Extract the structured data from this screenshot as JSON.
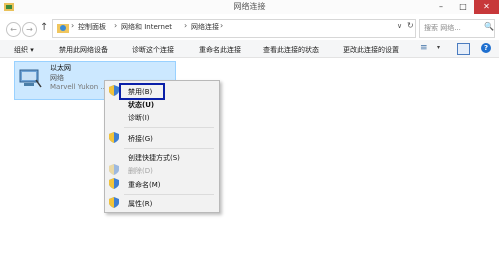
{
  "window": {
    "title": "网络连接",
    "controls": {
      "minimize": "–",
      "maximize": "□",
      "close": "✕"
    }
  },
  "address_bar": {
    "nav": {
      "back": "←",
      "forward": "→",
      "up": "↑"
    },
    "breadcrumbs": [
      "控制面板",
      "网络和 Internet",
      "网络连接"
    ],
    "separator": "›",
    "dropdown": "∨",
    "refresh": "↻",
    "search_placeholder": "搜索 网络...",
    "search_icon": "🔍"
  },
  "command_bar": {
    "items": [
      "组织 ▾",
      "禁用此网络设备",
      "诊断这个连接",
      "重命名此连接",
      "查看此连接的状态",
      "更改此连接的设置"
    ],
    "view_icon": "≡",
    "view_arrow": "▾",
    "help": "?"
  },
  "adapter": {
    "name": "以太网",
    "status": "网络",
    "device": "Marvell Yukon ..."
  },
  "context_menu": {
    "items": [
      {
        "label": "禁用(B)",
        "icon": "shield-icon",
        "bold": false,
        "disabled": false,
        "highlighted": true
      },
      {
        "label": "状态(U)",
        "icon": null,
        "bold": true,
        "disabled": false
      },
      {
        "label": "诊断(I)",
        "icon": null,
        "bold": false,
        "disabled": false
      },
      {
        "label": "桥接(G)",
        "icon": "shield-icon",
        "bold": false,
        "disabled": false
      },
      {
        "label": "创建快捷方式(S)",
        "icon": null,
        "bold": false,
        "disabled": false
      },
      {
        "label": "删除(D)",
        "icon": "shield-icon",
        "bold": false,
        "disabled": true
      },
      {
        "label": "重命名(M)",
        "icon": "shield-icon",
        "bold": false,
        "disabled": false
      },
      {
        "label": "属性(R)",
        "icon": "shield-icon",
        "bold": false,
        "disabled": false
      }
    ]
  },
  "colors": {
    "selection_fill": "#cce8ff",
    "highlight_border": "#0a1fa8",
    "close_button": "#c7383a"
  }
}
